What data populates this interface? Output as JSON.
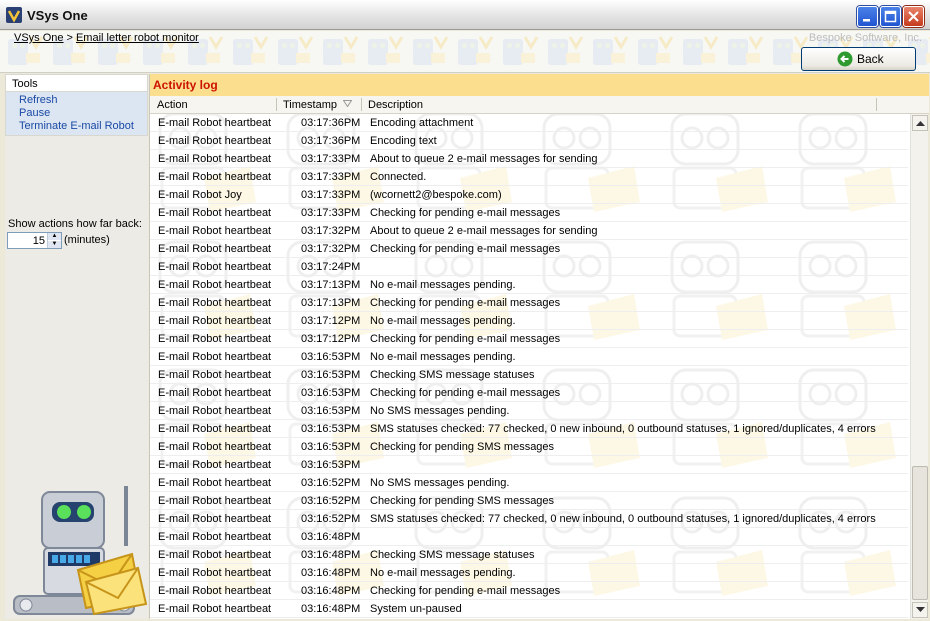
{
  "window": {
    "title": "VSys One",
    "app_icon": "vsys-logo-icon"
  },
  "header": {
    "breadcrumb": [
      {
        "label": "VSys One"
      },
      {
        "label": "Email letter robot monitor"
      }
    ],
    "separator": ">",
    "brand": "Bespoke Software, Inc.",
    "back_label": "Back"
  },
  "sidebar": {
    "tools_title": "Tools",
    "tools": [
      {
        "label": "Refresh"
      },
      {
        "label": "Pause"
      },
      {
        "label": "Terminate E-mail Robot"
      }
    ],
    "show_back_label": "Show actions how far back:",
    "show_back_value": "15",
    "show_back_unit": "(minutes)"
  },
  "activity": {
    "title": "Activity log",
    "columns": {
      "action": "Action",
      "timestamp": "Timestamp",
      "description": "Description"
    },
    "sort_column": "timestamp",
    "rows": [
      {
        "action": "E-mail Robot heartbeat",
        "time": "03:17:36PM",
        "desc": "Encoding attachment"
      },
      {
        "action": "E-mail Robot heartbeat",
        "time": "03:17:36PM",
        "desc": "Encoding text"
      },
      {
        "action": "E-mail Robot heartbeat",
        "time": "03:17:33PM",
        "desc": "About to queue 2 e-mail messages for sending"
      },
      {
        "action": "E-mail Robot heartbeat",
        "time": "03:17:33PM",
        "desc": "Connected."
      },
      {
        "action": "E-mail Robot Joy",
        "time": "03:17:33PM",
        "desc": "(wcornett2@bespoke.com)"
      },
      {
        "action": "E-mail Robot heartbeat",
        "time": "03:17:33PM",
        "desc": "Checking for pending e-mail messages"
      },
      {
        "action": "E-mail Robot heartbeat",
        "time": "03:17:32PM",
        "desc": "About to queue 2 e-mail messages for sending"
      },
      {
        "action": "E-mail Robot heartbeat",
        "time": "03:17:32PM",
        "desc": "Checking for pending e-mail messages"
      },
      {
        "action": "E-mail Robot heartbeat",
        "time": "03:17:24PM",
        "desc": ""
      },
      {
        "action": "E-mail Robot heartbeat",
        "time": "03:17:13PM",
        "desc": "No e-mail messages pending."
      },
      {
        "action": "E-mail Robot heartbeat",
        "time": "03:17:13PM",
        "desc": "Checking for pending e-mail messages"
      },
      {
        "action": "E-mail Robot heartbeat",
        "time": "03:17:12PM",
        "desc": "No e-mail messages pending."
      },
      {
        "action": "E-mail Robot heartbeat",
        "time": "03:17:12PM",
        "desc": "Checking for pending e-mail messages"
      },
      {
        "action": "E-mail Robot heartbeat",
        "time": "03:16:53PM",
        "desc": "No e-mail messages pending."
      },
      {
        "action": "E-mail Robot heartbeat",
        "time": "03:16:53PM",
        "desc": "Checking SMS message statuses"
      },
      {
        "action": "E-mail Robot heartbeat",
        "time": "03:16:53PM",
        "desc": "Checking for pending e-mail messages"
      },
      {
        "action": "E-mail Robot heartbeat",
        "time": "03:16:53PM",
        "desc": "No SMS messages pending."
      },
      {
        "action": "E-mail Robot heartbeat",
        "time": "03:16:53PM",
        "desc": "SMS statuses checked: 77 checked, 0 new inbound, 0 outbound statuses, 1 ignored/duplicates, 4 errors"
      },
      {
        "action": "E-mail Robot heartbeat",
        "time": "03:16:53PM",
        "desc": "Checking for pending SMS messages"
      },
      {
        "action": "E-mail Robot heartbeat",
        "time": "03:16:53PM",
        "desc": ""
      },
      {
        "action": "E-mail Robot heartbeat",
        "time": "03:16:52PM",
        "desc": "No SMS messages pending."
      },
      {
        "action": "E-mail Robot heartbeat",
        "time": "03:16:52PM",
        "desc": "Checking for pending SMS messages"
      },
      {
        "action": "E-mail Robot heartbeat",
        "time": "03:16:52PM",
        "desc": "SMS statuses checked: 77 checked, 0 new inbound, 0 outbound statuses, 1 ignored/duplicates, 4 errors"
      },
      {
        "action": "E-mail Robot heartbeat",
        "time": "03:16:48PM",
        "desc": ""
      },
      {
        "action": "E-mail Robot heartbeat",
        "time": "03:16:48PM",
        "desc": "Checking SMS message statuses"
      },
      {
        "action": "E-mail Robot heartbeat",
        "time": "03:16:48PM",
        "desc": "No e-mail messages pending."
      },
      {
        "action": "E-mail Robot heartbeat",
        "time": "03:16:48PM",
        "desc": "Checking for pending e-mail messages"
      },
      {
        "action": "E-mail Robot heartbeat",
        "time": "03:16:48PM",
        "desc": "System un-paused"
      }
    ]
  },
  "colors": {
    "panel_title_bg": "#fbdf8e",
    "panel_title_text": "#cc1100",
    "link": "#1a4aa6",
    "tools_bg": "#dce5f2"
  }
}
